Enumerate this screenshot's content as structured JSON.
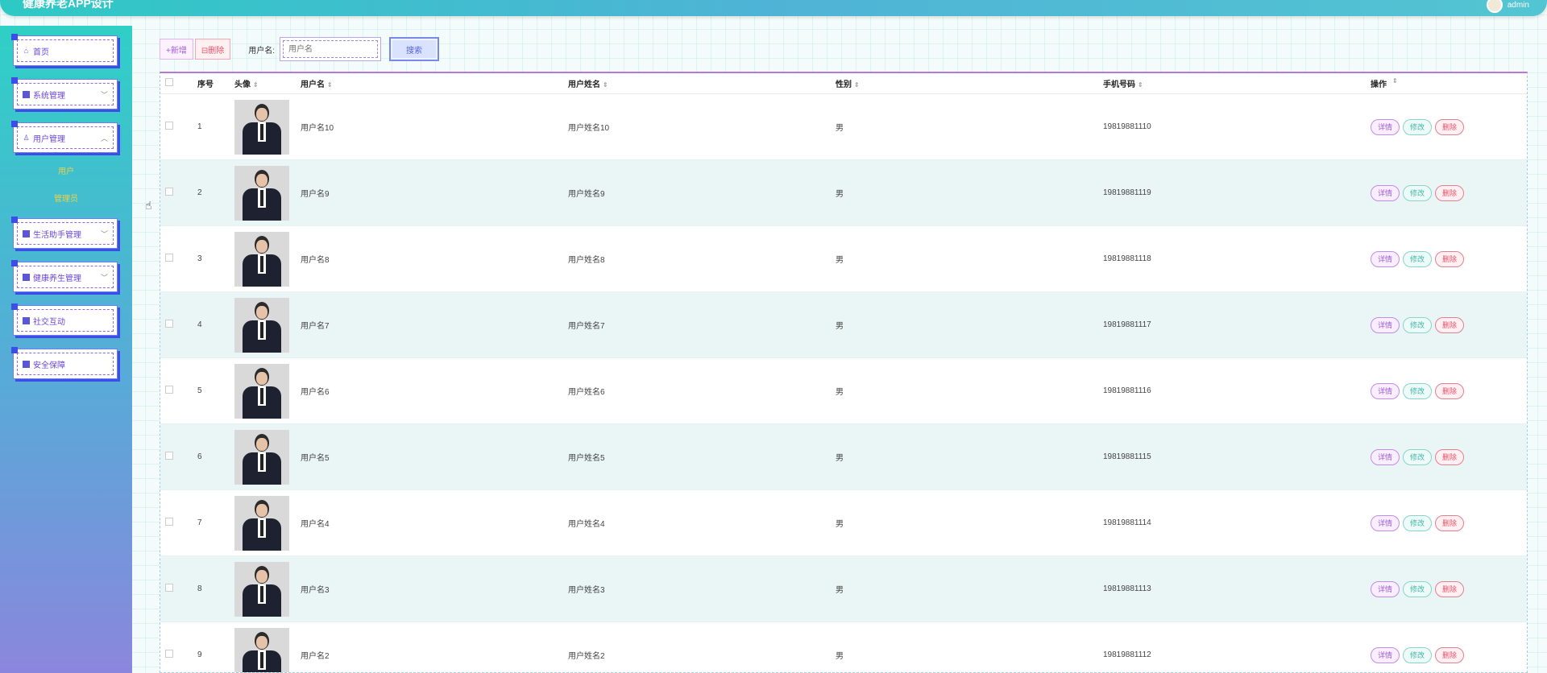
{
  "header": {
    "title": "健康养老APP设计",
    "username": "admin"
  },
  "sidebar": {
    "items": [
      {
        "label": "首页",
        "icon": "home-icon"
      },
      {
        "label": "系统管理",
        "icon": "grid-icon",
        "chevron": "﹀"
      },
      {
        "label": "用户管理",
        "icon": "user-icon",
        "chevron": "︿"
      },
      {
        "label": "生活助手管理",
        "icon": "grid-icon",
        "chevron": "﹀"
      },
      {
        "label": "健康养生管理",
        "icon": "grid-icon",
        "chevron": "﹀"
      },
      {
        "label": "社交互动",
        "icon": "grid-icon"
      },
      {
        "label": "安全保障",
        "icon": "grid-icon"
      }
    ],
    "subitems": [
      "用户",
      "管理员"
    ]
  },
  "toolbar": {
    "add_label": "+新增",
    "delete_label": "⊟删除",
    "search_label": "用户名:",
    "search_placeholder": "用户名",
    "search_button": "搜索"
  },
  "table": {
    "headers": {
      "index": "序号",
      "avatar": "头像",
      "username": "用户名",
      "name": "用户姓名",
      "sex": "性别",
      "phone": "手机号码",
      "ops": "操作"
    },
    "sort_glyph": "⇕",
    "ops": {
      "detail": "详情",
      "edit": "修改",
      "remove": "删除"
    },
    "rows": [
      {
        "index": "1",
        "username": "用户名10",
        "name": "用户姓名10",
        "sex": "男",
        "phone": "19819881110"
      },
      {
        "index": "2",
        "username": "用户名9",
        "name": "用户姓名9",
        "sex": "男",
        "phone": "19819881119"
      },
      {
        "index": "3",
        "username": "用户名8",
        "name": "用户姓名8",
        "sex": "男",
        "phone": "19819881118"
      },
      {
        "index": "4",
        "username": "用户名7",
        "name": "用户姓名7",
        "sex": "男",
        "phone": "19819881117"
      },
      {
        "index": "5",
        "username": "用户名6",
        "name": "用户姓名6",
        "sex": "男",
        "phone": "19819881116"
      },
      {
        "index": "6",
        "username": "用户名5",
        "name": "用户姓名5",
        "sex": "男",
        "phone": "19819881115"
      },
      {
        "index": "7",
        "username": "用户名4",
        "name": "用户姓名4",
        "sex": "男",
        "phone": "19819881114"
      },
      {
        "index": "8",
        "username": "用户名3",
        "name": "用户姓名3",
        "sex": "男",
        "phone": "19819881113"
      },
      {
        "index": "9",
        "username": "用户名2",
        "name": "用户姓名2",
        "sex": "男",
        "phone": "19819881112"
      }
    ]
  },
  "colors": {
    "accent_purple": "#a25cd6",
    "accent_teal": "#3fb7a8",
    "danger": "#e3526b",
    "header_bg": "#2ec9c5"
  }
}
